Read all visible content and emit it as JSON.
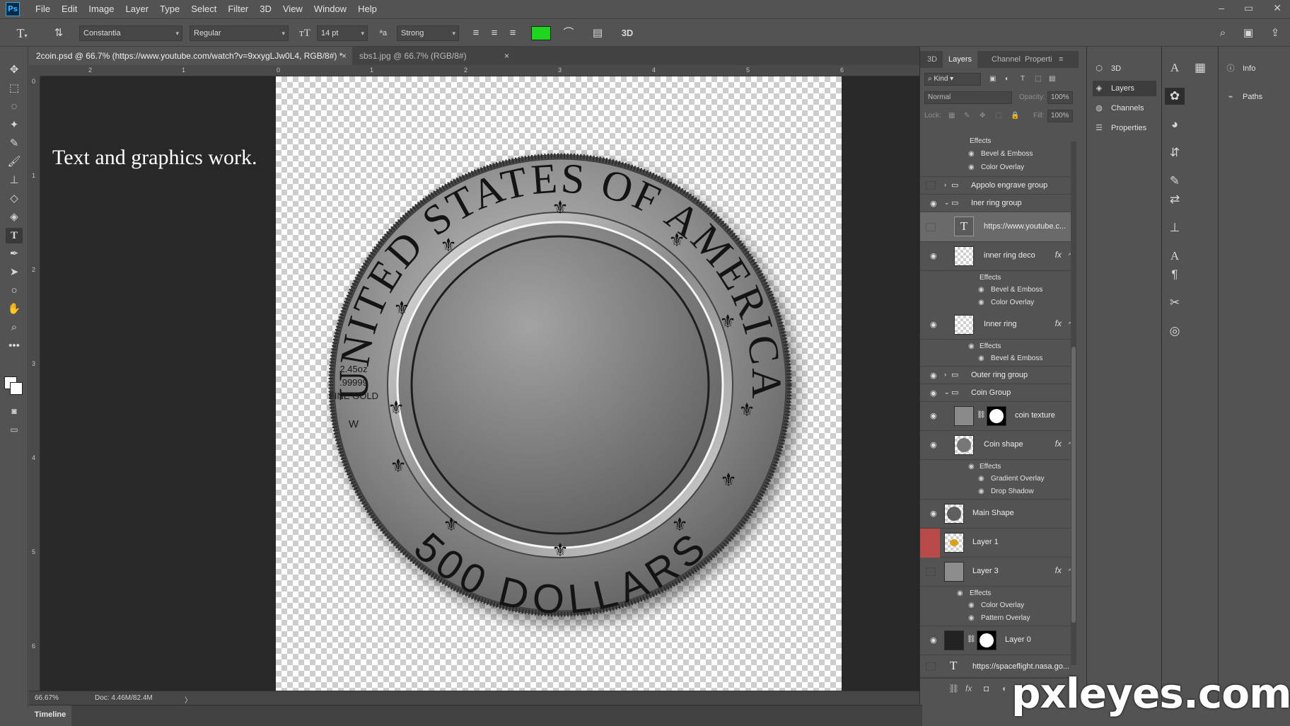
{
  "app": {
    "logo_text": "Ps"
  },
  "menu": [
    "File",
    "Edit",
    "Image",
    "Layer",
    "Type",
    "Select",
    "Filter",
    "3D",
    "View",
    "Window",
    "Help"
  ],
  "window_controls": {
    "minimize": "–",
    "restore": "▭",
    "close": "✕"
  },
  "options_bar": {
    "font_family": "Constantia",
    "font_style": "Regular",
    "font_size": "14 pt",
    "aa_label": "ªa",
    "anti_alias": "Strong",
    "text_color": "#1ed61e",
    "mode_3d": "3D"
  },
  "doc_tabs": [
    {
      "title": "2coin.psd @ 66.7% (https://www.youtube.com/watch?v=9xxygLJw0L4, RGB/8#) *",
      "close": "×"
    },
    {
      "title": "sbs1.jpg @ 66.7% (RGB/8#)",
      "close": "×"
    }
  ],
  "ruler": {
    "top": [
      "2",
      "1",
      "0",
      "1",
      "2",
      "3",
      "4",
      "5",
      "6"
    ],
    "left": [
      "0",
      "1",
      "2",
      "3",
      "4",
      "5",
      "6"
    ]
  },
  "canvas": {
    "note": "Text and graphics work.",
    "coin": {
      "top_text": "UNITED STATES OF AMERICA",
      "bottom_text": "500 DOLLARS",
      "weight": "2.45oz",
      "purity": ".99999",
      "metal": "FINE GOLD",
      "mint_mark": "W",
      "fleur": "⚜"
    }
  },
  "status": {
    "zoom": "66.67%",
    "doc": "Doc: 4.46M/82.4M",
    "arrow": "〉"
  },
  "timeline": {
    "label": "Timeline"
  },
  "layers_panel": {
    "tabs": [
      "3D",
      "Layers",
      "Channel",
      "Properti"
    ],
    "kind_filter": "Kind",
    "blend_mode": "Normal",
    "opacity_label": "Opacity:",
    "opacity_value": "100%",
    "lock_label": "Lock:",
    "fill_label": "Fill:",
    "fill_value": "100%",
    "effects_label": "Effects",
    "top_effects": [
      "Bevel & Emboss",
      "Color Overlay"
    ],
    "layers": [
      {
        "name": "Appolo engrave group"
      },
      {
        "name": "Iner ring group"
      },
      {
        "name": "https://www.youtube.c..."
      },
      {
        "name": "inner ring deco",
        "effects": [
          "Bevel & Emboss",
          "Color Overlay"
        ]
      },
      {
        "name": "Inner ring",
        "effects": [
          "Bevel & Emboss"
        ]
      },
      {
        "name": "Outer ring group"
      },
      {
        "name": "Coin Group"
      },
      {
        "name": "coin texture"
      },
      {
        "name": "Coin shape",
        "effects": [
          "Gradient Overlay",
          "Drop Shadow"
        ]
      },
      {
        "name": "Main Shape"
      },
      {
        "name": "Layer 1"
      },
      {
        "name": "Layer 3",
        "effects": [
          "Color Overlay",
          "Pattern Overlay"
        ]
      },
      {
        "name": "Layer 0"
      },
      {
        "name": "https://spaceflight.nasa.go..."
      }
    ]
  },
  "dock_left": [
    "3D",
    "Layers",
    "Channels",
    "Properties"
  ],
  "dock_right": [
    "Info",
    "Paths"
  ],
  "watermark": "pxleyes.com"
}
